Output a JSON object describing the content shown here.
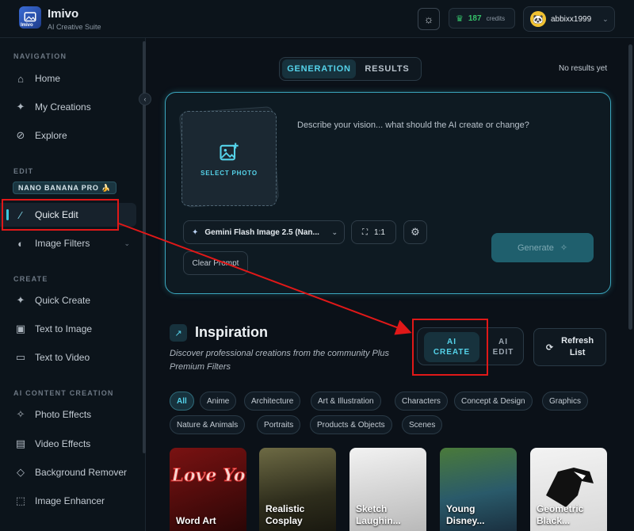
{
  "app": {
    "name": "Imivo",
    "subtitle": "AI Creative Suite",
    "logo_text": "Imivo"
  },
  "header": {
    "credits_count": "187",
    "credits_label": "credits",
    "username": "abbixx1999"
  },
  "sidebar": {
    "navigation_label": "NAVIGATION",
    "navigation": [
      {
        "label": "Home",
        "icon": "home-icon"
      },
      {
        "label": "My Creations",
        "icon": "sparkle-icon"
      },
      {
        "label": "Explore",
        "icon": "compass-icon"
      }
    ],
    "edit_label": "EDIT",
    "edit_badge": "NANO BANANA PRO 🍌",
    "edit": [
      {
        "label": "Quick Edit",
        "icon": "magic-wand-icon",
        "active": true
      },
      {
        "label": "Image Filters",
        "icon": "palette-icon",
        "expandable": true
      }
    ],
    "create_label": "CREATE",
    "create": [
      {
        "label": "Quick Create",
        "icon": "sparkle-icon"
      },
      {
        "label": "Text to Image",
        "icon": "image-icon"
      },
      {
        "label": "Text to Video",
        "icon": "video-icon"
      }
    ],
    "ai_label": "AI CONTENT CREATION",
    "ai": [
      {
        "label": "Photo Effects",
        "icon": "sparkle-icon"
      },
      {
        "label": "Video Effects",
        "icon": "film-icon"
      },
      {
        "label": "Background Remover",
        "icon": "eraser-icon"
      },
      {
        "label": "Image Enhancer",
        "icon": "enhance-icon"
      }
    ]
  },
  "main": {
    "tabs": [
      "GENERATION",
      "RESULTS"
    ],
    "no_results": "No results yet",
    "select_photo": "SELECT PHOTO",
    "prompt_placeholder": "Describe your vision... what should the AI create or change?",
    "model": "Gemini Flash Image 2.5 (Nan...",
    "ratio": "1:1",
    "clear_prompt": "Clear Prompt",
    "generate": "Generate"
  },
  "inspiration": {
    "title": "Inspiration",
    "description": "Discover professional creations from the community Plus Premium Filters",
    "mode_create_line1": "AI",
    "mode_create_line2": "CREATE",
    "mode_edit_line1": "AI",
    "mode_edit_line2": "EDIT",
    "refresh_line1": "Refresh",
    "refresh_line2": "List",
    "categories": [
      "All",
      "Anime",
      "Architecture",
      "Art & Illustration",
      "Characters",
      "Concept & Design",
      "Graphics",
      "Nature & Animals",
      "Portraits",
      "Products & Objects",
      "Scenes"
    ],
    "cards": [
      {
        "line1": "Word Art",
        "line2": "",
        "art_text": "I Love You"
      },
      {
        "line1": "Realistic",
        "line2": "Cosplay"
      },
      {
        "line1": "Sketch",
        "line2": "Laughin..."
      },
      {
        "line1": "Young",
        "line2": "Disney..."
      },
      {
        "line1": "Geometric",
        "line2": "Black..."
      }
    ]
  },
  "colors": {
    "accent": "#55d3ea",
    "credits": "#36c26a",
    "annotation": "#e01818"
  }
}
